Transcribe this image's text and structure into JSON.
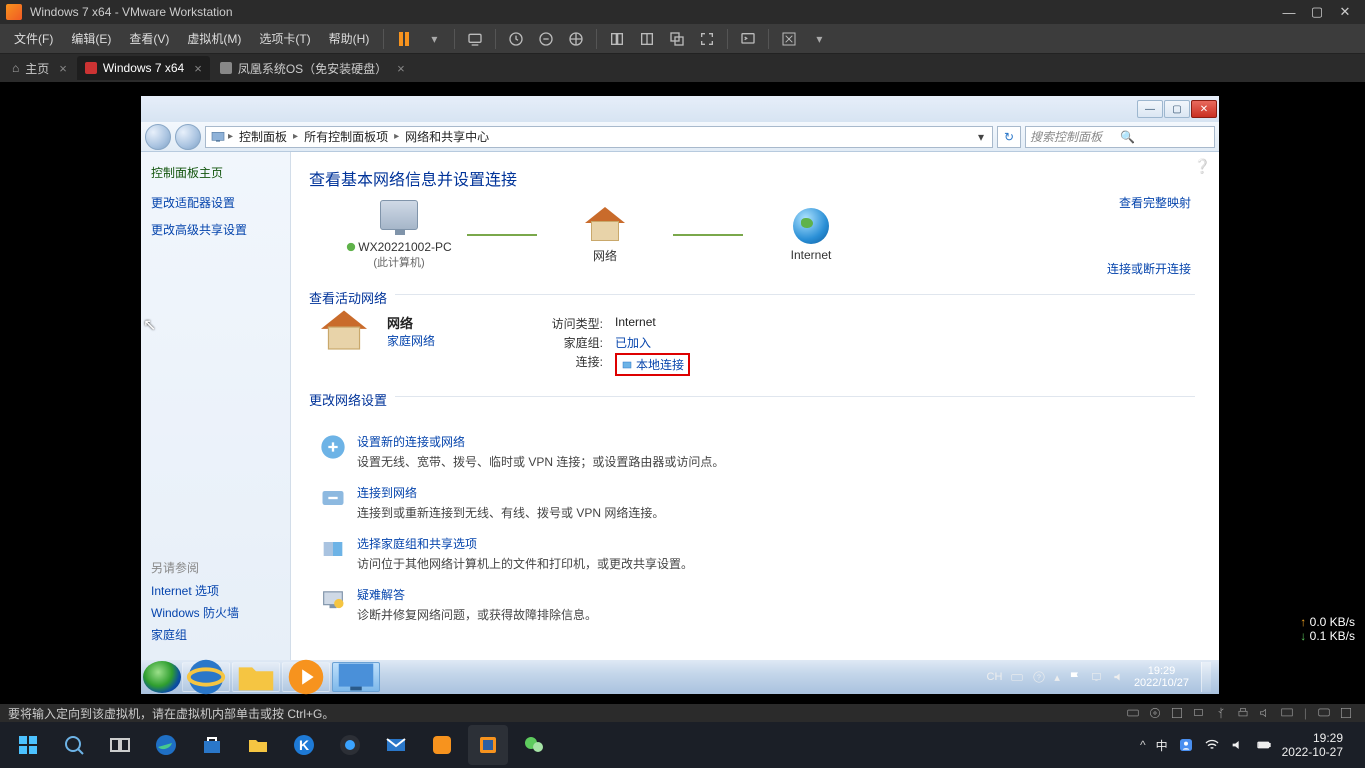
{
  "vmware": {
    "title": "Windows 7 x64 - VMware Workstation",
    "menu": [
      "文件(F)",
      "编辑(E)",
      "查看(V)",
      "虚拟机(M)",
      "选项卡(T)",
      "帮助(H)"
    ],
    "tabs": {
      "home": "主页",
      "active": "Windows 7 x64",
      "other": "凤凰系统OS（免安装硬盘）"
    },
    "status": "要将输入定向到该虚拟机，请在虚拟机内部单击或按 Ctrl+G。"
  },
  "xfer": {
    "up": "0.0 KB/s",
    "down": "0.1 KB/s"
  },
  "win7": {
    "breadcrumb": [
      "控制面板",
      "所有控制面板项",
      "网络和共享中心"
    ],
    "search_placeholder": "搜索控制面板",
    "sidebar": {
      "home": "控制面板主页",
      "links": [
        "更改适配器设置",
        "更改高级共享设置"
      ],
      "related_header": "另请参阅",
      "related": [
        "Internet 选项",
        "Windows 防火墙",
        "家庭组"
      ]
    },
    "content": {
      "title": "查看基本网络信息并设置连接",
      "map_full_link": "查看完整映射",
      "nodes": {
        "pc": "WX20221002-PC",
        "pc_sub": "(此计算机)",
        "network": "网络",
        "internet": "Internet"
      },
      "active_section": "查看活动网络",
      "conn_link": "连接或断开连接",
      "active": {
        "name": "网络",
        "type": "家庭网络",
        "access_label": "访问类型:",
        "access_value": "Internet",
        "homegroup_label": "家庭组:",
        "homegroup_value": "已加入",
        "conn_label": "连接:",
        "conn_value": "本地连接"
      },
      "change_section": "更改网络设置",
      "tasks": [
        {
          "title": "设置新的连接或网络",
          "desc": "设置无线、宽带、拨号、临时或 VPN 连接；或设置路由器或访问点。"
        },
        {
          "title": "连接到网络",
          "desc": "连接到或重新连接到无线、有线、拨号或 VPN 网络连接。"
        },
        {
          "title": "选择家庭组和共享选项",
          "desc": "访问位于其他网络计算机上的文件和打印机，或更改共享设置。"
        },
        {
          "title": "疑难解答",
          "desc": "诊断并修复网络问题，或获得故障排除信息。"
        }
      ]
    },
    "taskbar": {
      "ime": "CH",
      "time": "19:29",
      "date": "2022/10/27"
    }
  },
  "host": {
    "ime": "中",
    "time": "19:29",
    "date": "2022-10-27"
  }
}
